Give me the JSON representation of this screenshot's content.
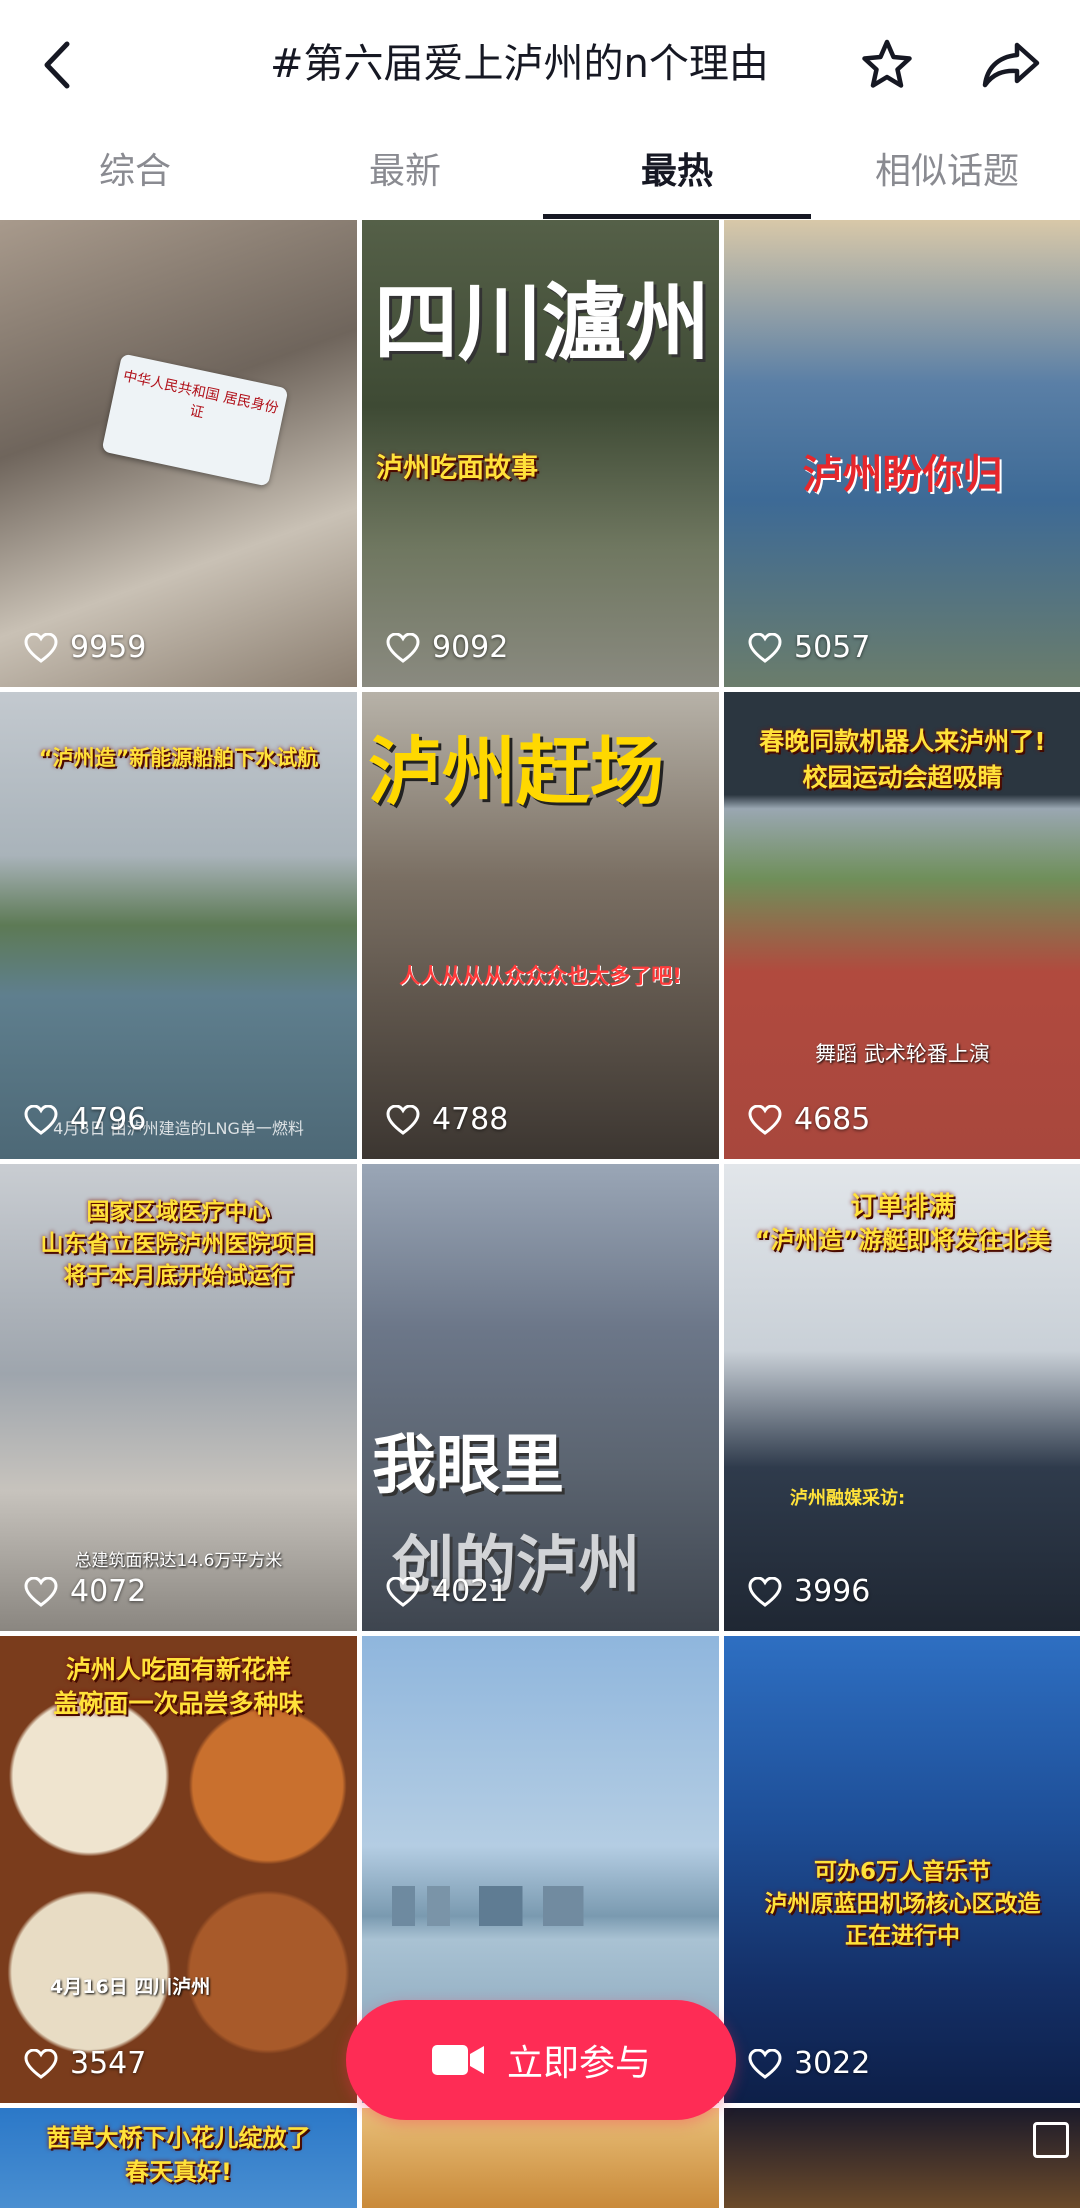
{
  "header": {
    "title": "#第六届爱上泸州的n个理由"
  },
  "tabs": [
    {
      "label": "综合"
    },
    {
      "label": "最新"
    },
    {
      "label": "最热"
    },
    {
      "label": "相似话题"
    }
  ],
  "active_tab": "最热",
  "videos": [
    {
      "likes": "9959",
      "caption": "中华人民共和国 居民身份证"
    },
    {
      "likes": "9092",
      "title": "四川瀘州",
      "caption": "泸州吃面故事"
    },
    {
      "likes": "5057",
      "caption": "泸州盼你归"
    },
    {
      "likes": "4796",
      "caption": "“泸州造”新能源船舶下水试航",
      "subcaption": "4月8日 由泸州建造的LNG单一燃料"
    },
    {
      "likes": "4788",
      "title": "泸州赶场",
      "caption": "人人从从从众众众也太多了吧!"
    },
    {
      "likes": "4685",
      "caption": "春晚同款机器人来泸州了!",
      "caption2": "校园运动会超吸睛",
      "subcaption": "舞蹈 武术轮番上演"
    },
    {
      "likes": "4072",
      "caption": "国家区域医疗中心",
      "caption2": "山东省立医院泸州医院项目",
      "caption3": "将于本月底开始试运行",
      "subcaption": "总建筑面积达14.6万平方米"
    },
    {
      "likes": "4021",
      "title": "我眼里",
      "caption": "创的泸州"
    },
    {
      "likes": "3996",
      "caption": "订单排满",
      "caption2": "“泸州造”游艇即将发往北美",
      "subcaption": "泸州融媒采访:"
    },
    {
      "likes": "3547",
      "caption": "泸州人吃面有新花样",
      "caption2": "盖碗面一次品尝多种味",
      "subcaption": "4月16日 四川泸州"
    },
    {
      "likes": "",
      "caption": ""
    },
    {
      "likes": "3022",
      "caption": "可办6万人音乐节",
      "caption2": "泸州原蓝田机场核心区改造",
      "caption3": "正在进行中"
    },
    {
      "likes": "",
      "caption": "茜草大桥下小花儿绽放了",
      "caption2": "春天真好!"
    }
  ],
  "join_button": {
    "label": "立即参与"
  },
  "colors": {
    "accent": "#fe2c55",
    "text": "#161823",
    "tab_inactive": "#8a8b91"
  }
}
